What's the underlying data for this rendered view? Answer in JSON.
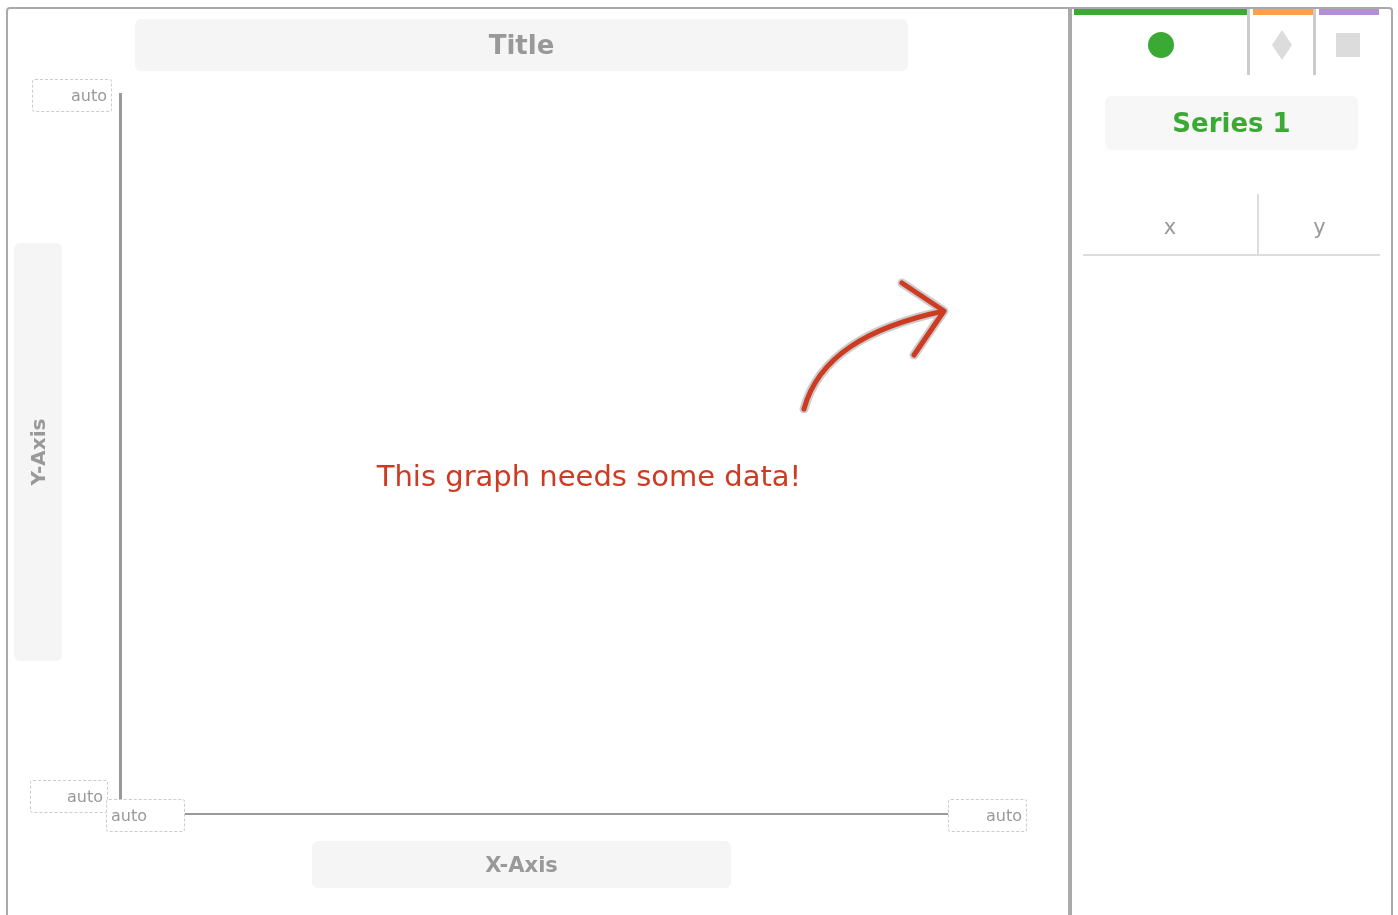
{
  "graph": {
    "title": "Title",
    "y_axis_label": "Y-Axis",
    "x_axis_label": "X-Axis",
    "y_max": "auto",
    "y_min": "auto",
    "x_min": "auto",
    "x_max": "auto",
    "message": "This graph needs some data!"
  },
  "series_tabs": [
    {
      "kind": "circle",
      "color": "#3aaa35",
      "selected": true
    },
    {
      "kind": "diamond",
      "color": "#ff9f4a",
      "selected": false
    },
    {
      "kind": "square",
      "color": "#b28fd6",
      "selected": false
    }
  ],
  "series": {
    "name": "Series 1",
    "color": "#3aaa35"
  },
  "table": {
    "columns": [
      "x",
      "y"
    ]
  }
}
